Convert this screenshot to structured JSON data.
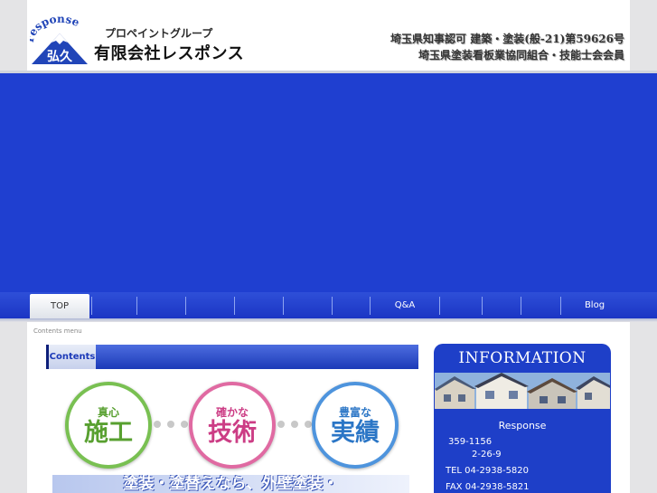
{
  "header": {
    "logo_arc_text": "response",
    "logo_kanji": "弘久",
    "group_name": "プロペイントグループ",
    "company_name": "有限会社レスポンス",
    "license_line1": "埼玉県知事認可 建築・塗装(般-21)第59626号",
    "license_line2": "埼玉県塗装看板業協同組合・技能士会会員"
  },
  "nav": {
    "items": [
      "TOP",
      "",
      "",
      "",
      "",
      "",
      "",
      "Q&A",
      "",
      "",
      "",
      "Blog"
    ]
  },
  "main": {
    "contents_menu_label": "Contents menu",
    "contents_tab_label": "Contents",
    "badges": [
      {
        "small": "真心",
        "big": "施工"
      },
      {
        "small": "確かな",
        "big": "技術"
      },
      {
        "small": "豊富な",
        "big": "実績"
      }
    ],
    "slogan": "塗装・塗替えなら、外壁塗装・"
  },
  "info": {
    "title": "INFORMATION",
    "name": "Response",
    "zip": "359-1156",
    "address": "2-26-9",
    "tel": "TEL 04-2938-5820",
    "fax": "FAX 04-2938-5821"
  },
  "colors": {
    "brand_blue": "#1f3fd0",
    "green": "#58a030",
    "pink": "#cc3d85",
    "blue": "#2b76c6"
  }
}
